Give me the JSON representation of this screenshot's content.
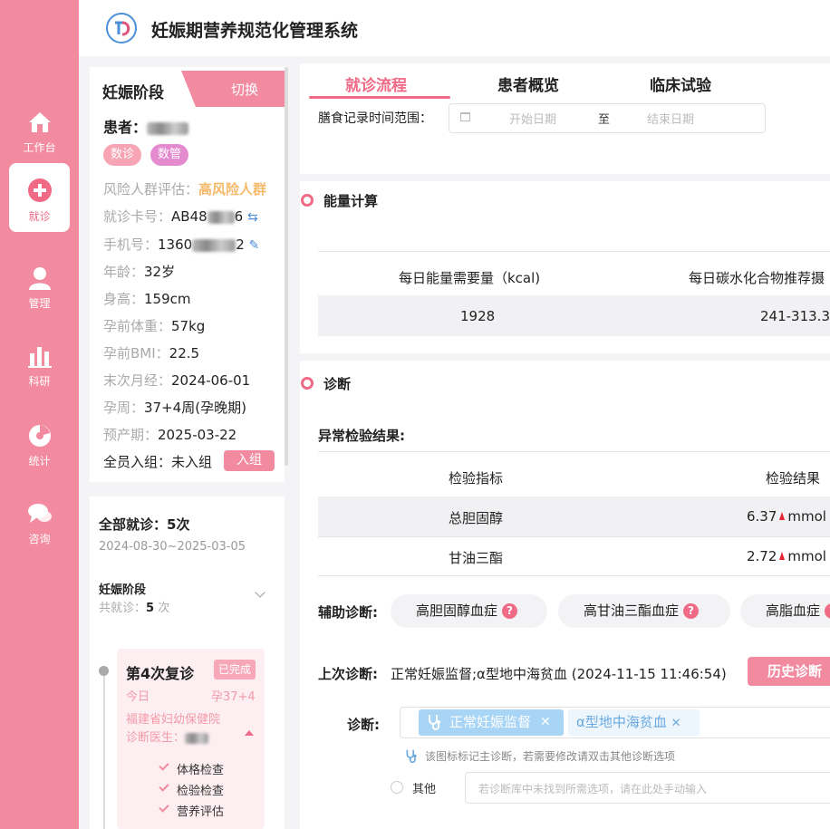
{
  "app": {
    "title": "妊娠期营养规范化管理系统"
  },
  "nav": [
    {
      "label": "工作台",
      "icon": "home-icon"
    },
    {
      "label": "就诊",
      "icon": "plus-circle-icon",
      "active": true
    },
    {
      "label": "管理",
      "icon": "user-icon"
    },
    {
      "label": "科研",
      "icon": "bar-chart-icon"
    },
    {
      "label": "统计",
      "icon": "pie-chart-icon"
    },
    {
      "label": "咨询",
      "icon": "chat-icon"
    }
  ],
  "patient": {
    "stage_title": "妊娠阶段",
    "switch_label": "切换",
    "name_label": "患者：",
    "badges": [
      "数诊",
      "数管"
    ],
    "rows": {
      "risk": {
        "k": "风险人群评估：",
        "v": "高风险人群"
      },
      "card": {
        "k": "就诊卡号：",
        "v_pre": "AB48",
        "v_post": "6"
      },
      "phone": {
        "k": "手机号：",
        "v_pre": "1360",
        "v_post": "2"
      },
      "age": {
        "k": "年龄：",
        "v": "32岁"
      },
      "height": {
        "k": "身高：",
        "v": "159cm"
      },
      "weight": {
        "k": "孕前体重：",
        "v": "57kg"
      },
      "bmi": {
        "k": "孕前BMI：",
        "v": "22.5"
      },
      "lmp": {
        "k": "末次月经：",
        "v": "2024-06-01"
      },
      "ga": {
        "k": "孕周：",
        "v": "37+4周(孕晚期)"
      },
      "edd": {
        "k": "预产期：",
        "v": "2025-03-22"
      },
      "enroll": {
        "k": "全员入组：",
        "v": "未入组"
      }
    },
    "join_label": "入组"
  },
  "visits": {
    "title": "全部就诊：5次",
    "range": "2024-08-30~2025-03-05",
    "stage": "妊娠阶段",
    "count_label": "共就诊：",
    "count": "5",
    "count_unit": " 次",
    "current": {
      "title": "第4次复诊",
      "status": "已完成",
      "date": "今日",
      "ga": "孕37+4",
      "hospital": "福建省妇幼保健院",
      "doctor_label": "诊断医生：",
      "checks": [
        "体格检查",
        "检验检查",
        "营养评估"
      ]
    }
  },
  "tabs": [
    "就诊流程",
    "患者概览",
    "临床试验"
  ],
  "diet": {
    "label": "膳食记录时间范围：",
    "start_placeholder": "开始日期",
    "separator": "至",
    "end_placeholder": "结束日期"
  },
  "energy": {
    "title": "能量计算",
    "headers": [
      "每日能量需要量（kcal)",
      "每日碳水化合物推荐摄"
    ],
    "values": [
      "1928",
      "241-313.3"
    ]
  },
  "diagnosis": {
    "title": "诊断",
    "abnormal_label": "异常检验结果:",
    "lab_headers": [
      "检验指标",
      "检验结果"
    ],
    "labs": [
      {
        "name": "总胆固醇",
        "value": "6.37",
        "unit": "mmol"
      },
      {
        "name": "甘油三酯",
        "value": "2.72",
        "unit": "mmol"
      }
    ],
    "aux_label": "辅助诊断:",
    "aux_chips": [
      "高胆固醇血症",
      "高甘油三酯血症",
      "高脂血症"
    ],
    "last_label": "上次诊断:",
    "last_value": "正常妊娠监督;α型地中海贫血 (2024-11-15 11:46:54)",
    "history_button": "历史诊断",
    "diag_label": "诊断:",
    "tags": [
      "正常妊娠监督",
      "α型地中海贫血"
    ],
    "hint": "该图标标记主诊断，若需要修改请双击其他诊断选项",
    "other_label": "其他",
    "other_placeholder": "若诊断库中未找到所需选项，请在此处手动输入"
  },
  "colors": {
    "primary": "#f38ba0",
    "accent": "#f06a86",
    "tag_blue": "#a8d5f5",
    "risk": "#f5b96a"
  }
}
